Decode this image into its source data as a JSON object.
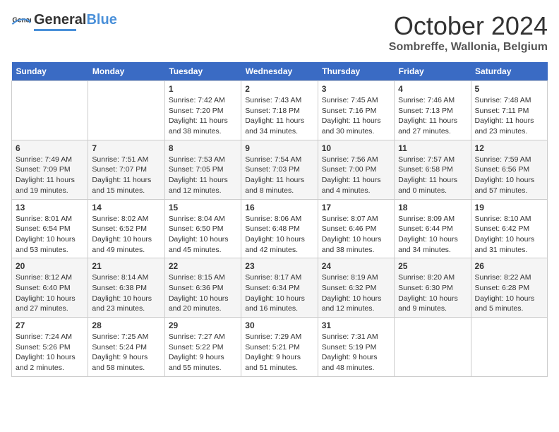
{
  "header": {
    "logo_general": "General",
    "logo_blue": "Blue",
    "month_title": "October 2024",
    "subtitle": "Sombreffe, Wallonia, Belgium"
  },
  "weekdays": [
    "Sunday",
    "Monday",
    "Tuesday",
    "Wednesday",
    "Thursday",
    "Friday",
    "Saturday"
  ],
  "weeks": [
    [
      {
        "day": "",
        "info": ""
      },
      {
        "day": "",
        "info": ""
      },
      {
        "day": "1",
        "info": "Sunrise: 7:42 AM\nSunset: 7:20 PM\nDaylight: 11 hours and 38 minutes."
      },
      {
        "day": "2",
        "info": "Sunrise: 7:43 AM\nSunset: 7:18 PM\nDaylight: 11 hours and 34 minutes."
      },
      {
        "day": "3",
        "info": "Sunrise: 7:45 AM\nSunset: 7:16 PM\nDaylight: 11 hours and 30 minutes."
      },
      {
        "day": "4",
        "info": "Sunrise: 7:46 AM\nSunset: 7:13 PM\nDaylight: 11 hours and 27 minutes."
      },
      {
        "day": "5",
        "info": "Sunrise: 7:48 AM\nSunset: 7:11 PM\nDaylight: 11 hours and 23 minutes."
      }
    ],
    [
      {
        "day": "6",
        "info": "Sunrise: 7:49 AM\nSunset: 7:09 PM\nDaylight: 11 hours and 19 minutes."
      },
      {
        "day": "7",
        "info": "Sunrise: 7:51 AM\nSunset: 7:07 PM\nDaylight: 11 hours and 15 minutes."
      },
      {
        "day": "8",
        "info": "Sunrise: 7:53 AM\nSunset: 7:05 PM\nDaylight: 11 hours and 12 minutes."
      },
      {
        "day": "9",
        "info": "Sunrise: 7:54 AM\nSunset: 7:03 PM\nDaylight: 11 hours and 8 minutes."
      },
      {
        "day": "10",
        "info": "Sunrise: 7:56 AM\nSunset: 7:00 PM\nDaylight: 11 hours and 4 minutes."
      },
      {
        "day": "11",
        "info": "Sunrise: 7:57 AM\nSunset: 6:58 PM\nDaylight: 11 hours and 0 minutes."
      },
      {
        "day": "12",
        "info": "Sunrise: 7:59 AM\nSunset: 6:56 PM\nDaylight: 10 hours and 57 minutes."
      }
    ],
    [
      {
        "day": "13",
        "info": "Sunrise: 8:01 AM\nSunset: 6:54 PM\nDaylight: 10 hours and 53 minutes."
      },
      {
        "day": "14",
        "info": "Sunrise: 8:02 AM\nSunset: 6:52 PM\nDaylight: 10 hours and 49 minutes."
      },
      {
        "day": "15",
        "info": "Sunrise: 8:04 AM\nSunset: 6:50 PM\nDaylight: 10 hours and 45 minutes."
      },
      {
        "day": "16",
        "info": "Sunrise: 8:06 AM\nSunset: 6:48 PM\nDaylight: 10 hours and 42 minutes."
      },
      {
        "day": "17",
        "info": "Sunrise: 8:07 AM\nSunset: 6:46 PM\nDaylight: 10 hours and 38 minutes."
      },
      {
        "day": "18",
        "info": "Sunrise: 8:09 AM\nSunset: 6:44 PM\nDaylight: 10 hours and 34 minutes."
      },
      {
        "day": "19",
        "info": "Sunrise: 8:10 AM\nSunset: 6:42 PM\nDaylight: 10 hours and 31 minutes."
      }
    ],
    [
      {
        "day": "20",
        "info": "Sunrise: 8:12 AM\nSunset: 6:40 PM\nDaylight: 10 hours and 27 minutes."
      },
      {
        "day": "21",
        "info": "Sunrise: 8:14 AM\nSunset: 6:38 PM\nDaylight: 10 hours and 23 minutes."
      },
      {
        "day": "22",
        "info": "Sunrise: 8:15 AM\nSunset: 6:36 PM\nDaylight: 10 hours and 20 minutes."
      },
      {
        "day": "23",
        "info": "Sunrise: 8:17 AM\nSunset: 6:34 PM\nDaylight: 10 hours and 16 minutes."
      },
      {
        "day": "24",
        "info": "Sunrise: 8:19 AM\nSunset: 6:32 PM\nDaylight: 10 hours and 12 minutes."
      },
      {
        "day": "25",
        "info": "Sunrise: 8:20 AM\nSunset: 6:30 PM\nDaylight: 10 hours and 9 minutes."
      },
      {
        "day": "26",
        "info": "Sunrise: 8:22 AM\nSunset: 6:28 PM\nDaylight: 10 hours and 5 minutes."
      }
    ],
    [
      {
        "day": "27",
        "info": "Sunrise: 7:24 AM\nSunset: 5:26 PM\nDaylight: 10 hours and 2 minutes."
      },
      {
        "day": "28",
        "info": "Sunrise: 7:25 AM\nSunset: 5:24 PM\nDaylight: 9 hours and 58 minutes."
      },
      {
        "day": "29",
        "info": "Sunrise: 7:27 AM\nSunset: 5:22 PM\nDaylight: 9 hours and 55 minutes."
      },
      {
        "day": "30",
        "info": "Sunrise: 7:29 AM\nSunset: 5:21 PM\nDaylight: 9 hours and 51 minutes."
      },
      {
        "day": "31",
        "info": "Sunrise: 7:31 AM\nSunset: 5:19 PM\nDaylight: 9 hours and 48 minutes."
      },
      {
        "day": "",
        "info": ""
      },
      {
        "day": "",
        "info": ""
      }
    ]
  ]
}
